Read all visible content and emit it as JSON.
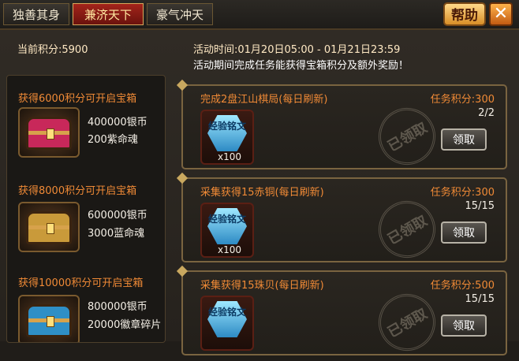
{
  "tabs": [
    {
      "label": "独善其身",
      "active": false
    },
    {
      "label": "兼济天下",
      "active": true
    },
    {
      "label": "豪气冲天",
      "active": false
    }
  ],
  "help_label": "帮助",
  "close_icon": "close-x-icon",
  "current_points": "当前积分:5900",
  "activity_time": "活动时间:01月20日05:00 - 01月21日23:59",
  "activity_desc": "活动期间完成任务能获得宝箱积分及额外奖励！",
  "chests": [
    {
      "title": "获得6000积分可开启宝箱",
      "reward1": "400000银币",
      "reward2": "200紫命魂",
      "color": "#c8285a"
    },
    {
      "title": "获得8000积分可开启宝箱",
      "reward1": "600000银币",
      "reward2": "3000蓝命魂",
      "color": "#c99a3a"
    },
    {
      "title": "获得10000积分可开启宝箱",
      "reward1": "800000银币",
      "reward2": "20000徽章碎片",
      "color": "#2f8fc6"
    }
  ],
  "tasks": [
    {
      "name": "完成2盘江山棋局(每日刷新)",
      "points": "任务积分:300",
      "progress": "2/2",
      "item_label": "经验铭文",
      "item_qty": "x100",
      "stamp": "已领取",
      "claim": "领取"
    },
    {
      "name": "采集获得15赤铜(每日刷新)",
      "points": "任务积分:300",
      "progress": "15/15",
      "item_label": "经验铭文",
      "item_qty": "x100",
      "stamp": "已领取",
      "claim": "领取"
    },
    {
      "name": "采集获得15珠贝(每日刷新)",
      "points": "任务积分:500",
      "progress": "15/15",
      "item_label": "经验铭文",
      "item_qty": "",
      "stamp": "已领取",
      "claim": "领取"
    }
  ]
}
